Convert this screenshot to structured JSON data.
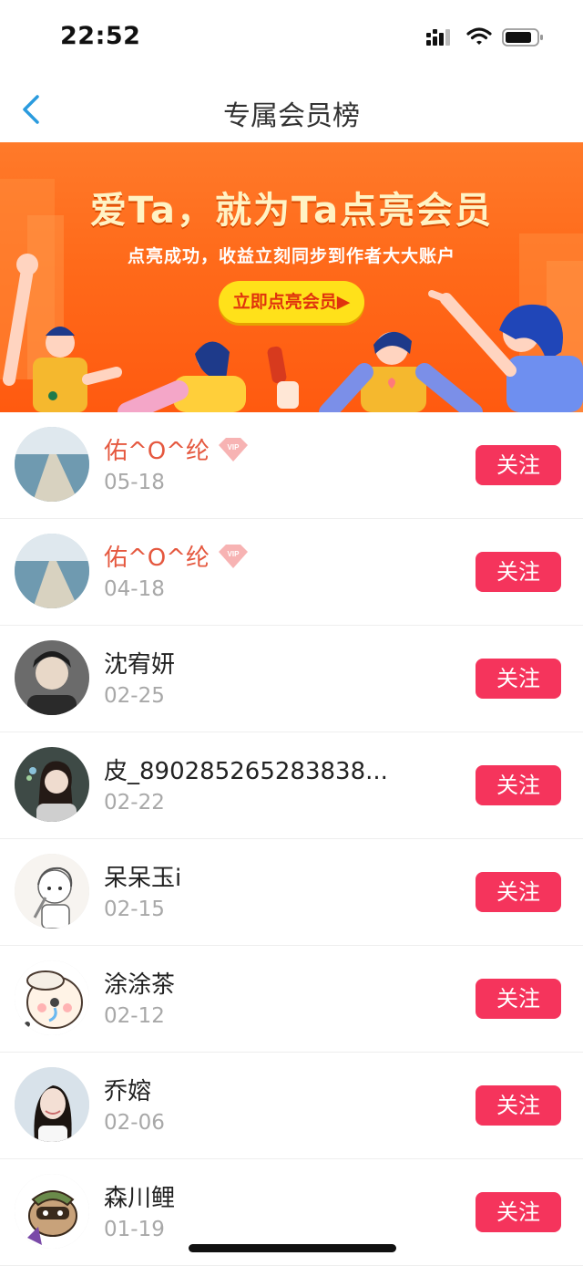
{
  "status_bar": {
    "time": "22:52"
  },
  "nav": {
    "title": "专属会员榜"
  },
  "banner": {
    "headline": "爱Ta，就为Ta点亮会员",
    "subtitle": "点亮成功，收益立刻同步到作者大大账户",
    "cta": "立即点亮会员▶"
  },
  "members": [
    {
      "name": "佑^O^纶",
      "date": "05-18",
      "vip": true,
      "follow": "关注",
      "vip_label": "VIP"
    },
    {
      "name": "佑^O^纶",
      "date": "04-18",
      "vip": true,
      "follow": "关注",
      "vip_label": "VIP"
    },
    {
      "name": "沈宥妍",
      "date": "02-25",
      "vip": false,
      "follow": "关注"
    },
    {
      "name": "皮_890285265283838...",
      "date": "02-22",
      "vip": false,
      "follow": "关注"
    },
    {
      "name": "呆呆玉i",
      "date": "02-15",
      "vip": false,
      "follow": "关注"
    },
    {
      "name": "涂涂茶",
      "date": "02-12",
      "vip": false,
      "follow": "关注"
    },
    {
      "name": "乔嫆",
      "date": "02-06",
      "vip": false,
      "follow": "关注"
    },
    {
      "name": "森川鲤",
      "date": "01-19",
      "vip": false,
      "follow": "关注"
    }
  ],
  "colors": {
    "accent": "#f5345c",
    "vip_name": "#e5583f",
    "banner": "#ff6a1a",
    "back_arrow": "#2a9bde"
  }
}
